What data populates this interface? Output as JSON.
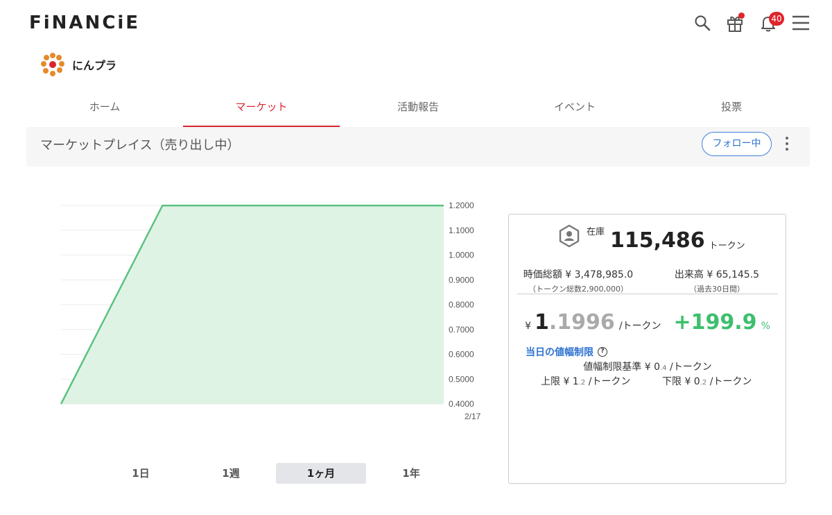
{
  "header": {
    "logo": "FiNANCiE",
    "notification_count": "40"
  },
  "project": {
    "name": "にんプラ"
  },
  "tabs": [
    {
      "label": "ホーム",
      "active": false
    },
    {
      "label": "マーケット",
      "active": true
    },
    {
      "label": "活動報告",
      "active": false
    },
    {
      "label": "イベント",
      "active": false
    },
    {
      "label": "投票",
      "active": false
    }
  ],
  "section": {
    "title": "マーケットプレイス（売り出し中）",
    "follow_label": "フォロー中"
  },
  "chart_data": {
    "type": "area",
    "x_labels": [
      "2/17"
    ],
    "y_ticks": [
      "1.2000",
      "1.1000",
      "1.0000",
      "0.9000",
      "0.8000",
      "0.7000",
      "0.6000",
      "0.5000",
      "0.4000"
    ],
    "ylim": [
      0.4,
      1.2
    ],
    "grid": true,
    "points": [
      {
        "x": 0,
        "y": 0.4
      },
      {
        "x": 0.265,
        "y": 1.1996
      },
      {
        "x": 1,
        "y": 1.1996
      }
    ],
    "colors": {
      "line": "#5cc27f",
      "fill": "#dff3e5"
    }
  },
  "periods": [
    {
      "label": "1日",
      "active": false
    },
    {
      "label": "1週",
      "active": false
    },
    {
      "label": "1ヶ月",
      "active": true
    },
    {
      "label": "1年",
      "active": false
    }
  ],
  "card": {
    "stock_label": "在庫",
    "stock_value": "115,486",
    "stock_unit": "トークン",
    "market_cap": "時価総額 ¥ 3,478,985.0",
    "market_cap_note": "（トークン総数2,900,000）",
    "volume": "出来高 ¥ 65,145.5",
    "volume_note": "（過去30日間）",
    "price_yen": "¥",
    "price_int": "1",
    "price_dec": ".1996",
    "price_unit": "/トークン",
    "change": "+199.9",
    "change_unit": "%",
    "limit_title": "当日の値幅制限",
    "limit_base_label": "値幅制限基準 ¥ 0",
    "limit_base_dec": ".4",
    "limit_upper_label": "上限 ¥ 1",
    "limit_upper_dec": ".2",
    "limit_lower_label": "下限 ¥ 0",
    "limit_lower_dec": ".2",
    "per_token": " /トークン",
    "help_symbol": "?"
  },
  "colors": {
    "accent_red": "#d8262e",
    "link_blue": "#2f73d0",
    "gain_green": "#3dbf6e"
  }
}
